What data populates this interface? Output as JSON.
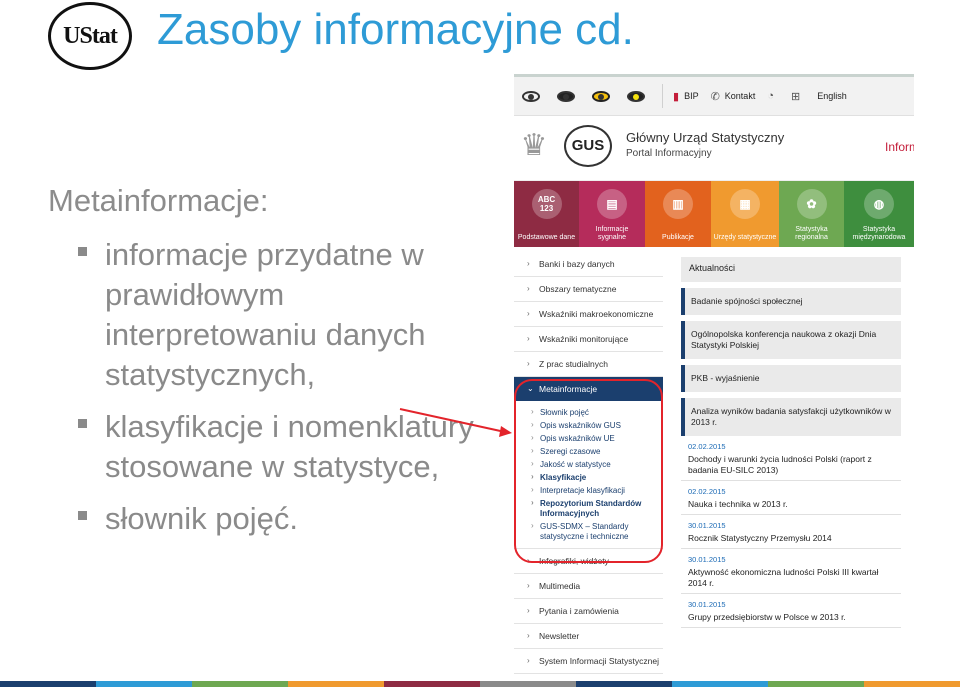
{
  "slide": {
    "title": "Zasoby informacyjne cd.",
    "logo_text": "UStat",
    "heading": "Metainformacje:",
    "bullets": [
      "informacje przydatne w prawidłowym interpretowaniu danych statystycznych,",
      "klasyfikacje i nomenklatury stosowane w statystyce,",
      "słownik pojęć."
    ]
  },
  "portal": {
    "topbar": {
      "bip": "BIP",
      "contact": "Kontakt",
      "english": "English"
    },
    "header": {
      "logo": "GUS",
      "title": "Główny Urząd Statystyczny",
      "subtitle": "Portal Informacyjny",
      "right": "Inform"
    },
    "tiles": [
      {
        "label": "Podstawowe dane",
        "icon": "ABC 123",
        "color": "#8e2b43"
      },
      {
        "label": "Informacje sygnalne",
        "icon": "doc-icon",
        "color": "#b52c5b"
      },
      {
        "label": "Publikacje",
        "icon": "book-icon",
        "color": "#e2621e"
      },
      {
        "label": "Urzędy statystyczne",
        "icon": "building-icon",
        "color": "#f09a2f"
      },
      {
        "label": "Statystyka regionalna",
        "icon": "map-icon",
        "color": "#6ea852"
      },
      {
        "label": "Statystyka międzynarodowa",
        "icon": "globe-icon",
        "color": "#3e8e3e"
      }
    ],
    "sidebar": {
      "items_top": [
        "Banki i bazy danych",
        "Obszary tematyczne",
        "Wskaźniki makroekonomiczne",
        "Wskaźniki monitorujące",
        "Z prac studialnych"
      ],
      "active": "Metainformacje",
      "sub_items": [
        {
          "label": "Słownik pojęć",
          "bold": false
        },
        {
          "label": "Opis wskaźników GUS",
          "bold": false
        },
        {
          "label": "Opis wskaźników UE",
          "bold": false
        },
        {
          "label": "Szeregi czasowe",
          "bold": false
        },
        {
          "label": "Jakość w statystyce",
          "bold": false
        },
        {
          "label": "Klasyfikacje",
          "bold": true
        },
        {
          "label": "Interpretacje klasyfikacji",
          "bold": false
        },
        {
          "label": "Repozytorium Standardów Informacyjnych",
          "bold": true
        },
        {
          "label": "GUS-SDMX – Standardy statystyczne i techniczne",
          "bold": false
        }
      ],
      "items_bottom": [
        "Infografiki, widżety",
        "Multimedia",
        "Pytania i zamówienia",
        "Newsletter",
        "System Informacji Statystycznej"
      ]
    },
    "news": {
      "heading": "Aktualności",
      "cards": [
        "Badanie spójności społecznej",
        "Ogólnopolska konferencja naukowa z okazji Dnia Statystyki Polskiej",
        "PKB - wyjaśnienie",
        "Analiza wyników badania satysfakcji użytkowników w 2013 r."
      ],
      "items": [
        {
          "date": "02.02.2015",
          "text": "Dochody i warunki życia ludności Polski (raport z badania EU-SILC 2013)"
        },
        {
          "date": "02.02.2015",
          "text": "Nauka i technika w 2013 r."
        },
        {
          "date": "30.01.2015",
          "text": "Rocznik Statystyczny Przemysłu 2014"
        },
        {
          "date": "30.01.2015",
          "text": "Aktywność ekonomiczna ludności Polski III kwartał 2014 r."
        },
        {
          "date": "30.01.2015",
          "text": "Grupy przedsiębiorstw w Polsce w 2013 r."
        }
      ]
    }
  },
  "colors": {
    "title": "#2e9bd6",
    "body_text": "#8a8a8a",
    "nav_active": "#1b3f6e",
    "highlight": "#e3242b"
  }
}
